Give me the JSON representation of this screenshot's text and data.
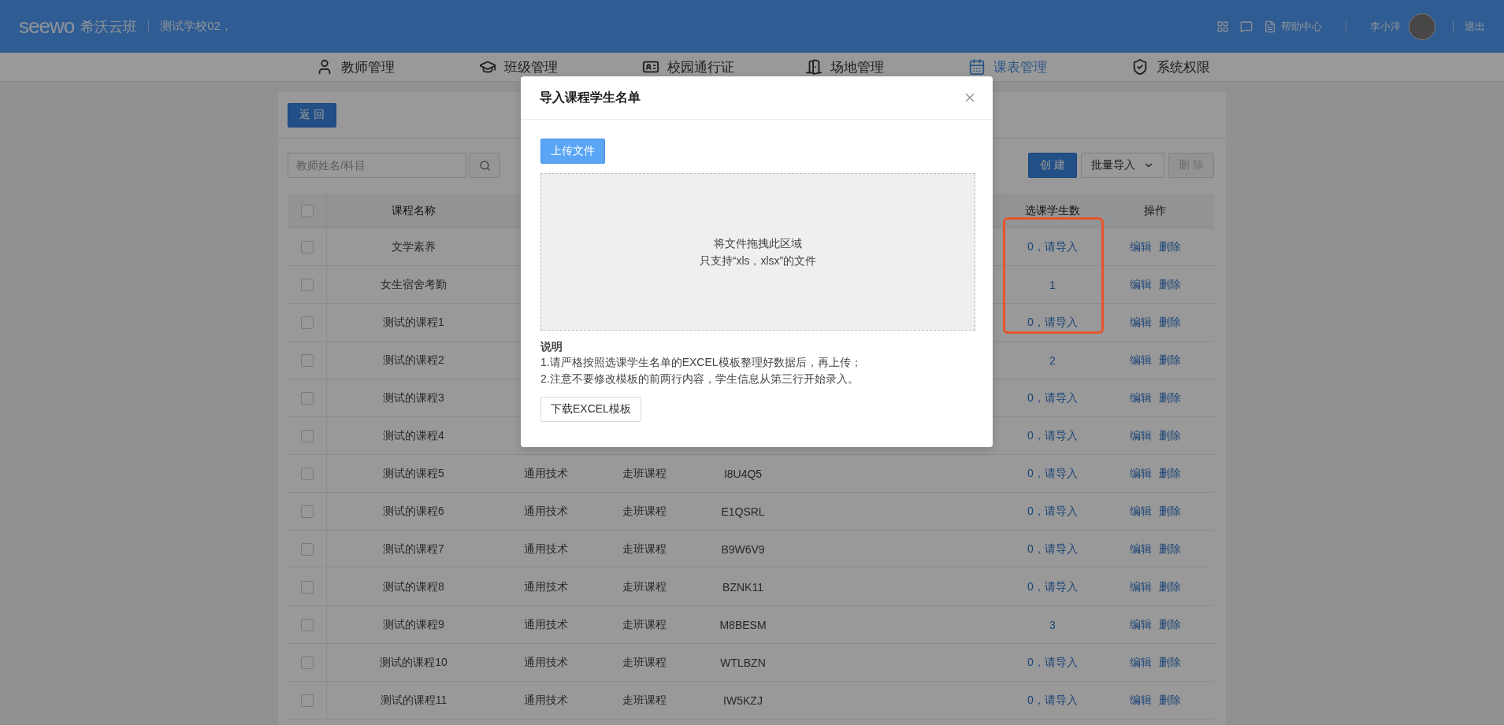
{
  "header": {
    "brand_logo": "seewo",
    "brand_name": "希沃云班",
    "school": "测试学校02，",
    "help": "帮助中心",
    "user": "李小洋",
    "logout": "退出"
  },
  "nav": [
    {
      "label": "教师管理",
      "selected": false
    },
    {
      "label": "班级管理",
      "selected": false
    },
    {
      "label": "校园通行证",
      "selected": false
    },
    {
      "label": "场地管理",
      "selected": false
    },
    {
      "label": "课表管理",
      "selected": true
    },
    {
      "label": "系统权限",
      "selected": false
    }
  ],
  "toolbar": {
    "back": "返 回",
    "search_placeholder": "教师姓名/科目",
    "create": "创 建",
    "bulk_import": "批量导入",
    "delete": {
      "label": "删 除",
      "disabled": true
    }
  },
  "table": {
    "header_checked": false,
    "columns": {
      "course_name": "课程名称",
      "students": "选课学生数",
      "actions": "操作"
    },
    "rows": [
      {
        "checked": false,
        "name": "文学素养",
        "students": "0，请导入",
        "edit": "编辑",
        "delete": "删除"
      },
      {
        "checked": false,
        "name": "女生宿舍考勤",
        "students": "1",
        "edit": "编辑",
        "delete": "删除"
      },
      {
        "checked": false,
        "name": "测试的课程1",
        "students": "0，请导入",
        "edit": "编辑",
        "delete": "删除"
      },
      {
        "checked": false,
        "name": "测试的课程2",
        "students": "2",
        "edit": "编辑",
        "delete": "删除"
      },
      {
        "checked": false,
        "name": "测试的课程3",
        "students": "0，请导入",
        "edit": "编辑",
        "delete": "删除"
      },
      {
        "checked": false,
        "name": "测试的课程4",
        "students": "0，请导入",
        "edit": "编辑",
        "delete": "删除"
      },
      {
        "checked": false,
        "name": "测试的课程5",
        "column_3": "通用技术",
        "column_4": "走班课程",
        "column_5": "I8U4Q5",
        "students": "0，请导入",
        "edit": "编辑",
        "delete": "删除"
      },
      {
        "checked": false,
        "name": "测试的课程6",
        "column_3": "通用技术",
        "column_4": "走班课程",
        "column_5": "E1QSRL",
        "students": "0，请导入",
        "edit": "编辑",
        "delete": "删除"
      },
      {
        "checked": false,
        "name": "测试的课程7",
        "column_3": "通用技术",
        "column_4": "走班课程",
        "column_5": "B9W6V9",
        "students": "0，请导入",
        "edit": "编辑",
        "delete": "删除"
      },
      {
        "checked": false,
        "name": "测试的课程8",
        "column_3": "通用技术",
        "column_4": "走班课程",
        "column_5": "BZNK11",
        "students": "0，请导入",
        "edit": "编辑",
        "delete": "删除"
      },
      {
        "checked": false,
        "name": "测试的课程9",
        "column_3": "通用技术",
        "column_4": "走班课程",
        "column_5": "M8BESM",
        "students": "3",
        "edit": "编辑",
        "delete": "删除"
      },
      {
        "checked": false,
        "name": "测试的课程10",
        "column_3": "通用技术",
        "column_4": "走班课程",
        "column_5": "WTLBZN",
        "students": "0，请导入",
        "edit": "编辑",
        "delete": "删除"
      },
      {
        "checked": false,
        "name": "测试的课程11",
        "column_3": "通用技术",
        "column_4": "走班课程",
        "column_5": "IW5KZJ",
        "students": "0，请导入",
        "edit": "编辑",
        "delete": "删除"
      }
    ]
  },
  "modal": {
    "title": "导入课程学生名单",
    "upload": "上传文件",
    "drop_lines": [
      "将文件拖拽此区域",
      "只支持“xls，xlsx”的文件"
    ],
    "notes_title": "说明",
    "notes": [
      "1.请严格按照选课学生名单的EXCEL模板整理好数据后，再上传；",
      "2.注意不要修改模板的前两行内容，学生信息从第三行开始录入。"
    ],
    "download": "下载EXCEL模板"
  }
}
